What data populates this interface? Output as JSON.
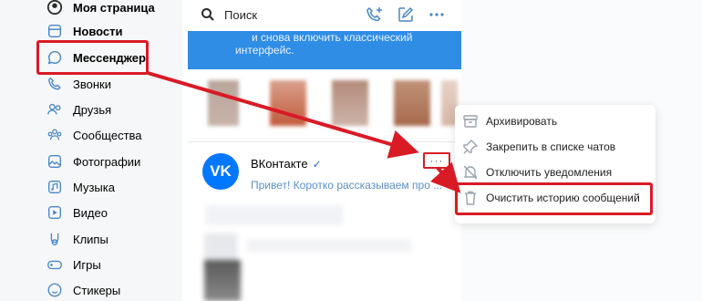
{
  "sidebar": {
    "items": [
      {
        "label": "Моя страница",
        "icon": "user-circle-icon"
      },
      {
        "label": "Новости",
        "icon": "news-icon"
      },
      {
        "label": "Мессенджер",
        "icon": "chat-bubble-icon"
      },
      {
        "label": "Звонки",
        "icon": "phone-icon"
      },
      {
        "label": "Друзья",
        "icon": "friends-icon"
      },
      {
        "label": "Сообщества",
        "icon": "communities-icon"
      },
      {
        "label": "Фотографии",
        "icon": "photo-icon"
      },
      {
        "label": "Музыка",
        "icon": "music-icon"
      },
      {
        "label": "Видео",
        "icon": "video-icon"
      },
      {
        "label": "Клипы",
        "icon": "clips-icon"
      },
      {
        "label": "Игры",
        "icon": "gamepad-icon"
      },
      {
        "label": "Стикеры",
        "icon": "sticker-icon"
      }
    ]
  },
  "chat": {
    "search_placeholder": "Поиск",
    "banner_line1": "и снова включить классический",
    "banner_line2": "интерфейс.",
    "conversation": {
      "name": "ВКонтакте",
      "verified_mark": "✓",
      "avatar_text": "VK",
      "preview": "Привет! Коротко рассказываем про ...",
      "more_label": "···"
    }
  },
  "context_menu": {
    "items": [
      {
        "label": "Архивировать",
        "icon": "archive-icon"
      },
      {
        "label": "Закрепить в списке чатов",
        "icon": "pin-icon"
      },
      {
        "label": "Отключить уведомления",
        "icon": "mute-icon"
      },
      {
        "label": "Очистить историю сообщений",
        "icon": "trash-icon"
      }
    ]
  },
  "colors": {
    "accent": "#2f8de6",
    "vk_blue": "#0077ff",
    "annotation_red": "#d91b26"
  }
}
